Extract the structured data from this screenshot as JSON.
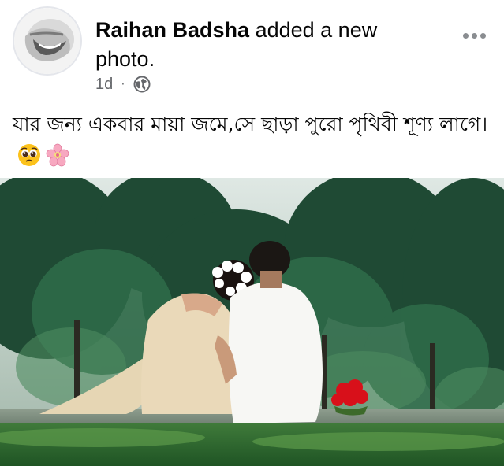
{
  "post": {
    "author": "Raihan Badsha",
    "action_text": "added a new photo.",
    "timestamp": "1d",
    "separator": "·",
    "privacy_icon": "globe-icon",
    "more_icon": "more-horizontal-icon",
    "caption": "যার জন্য একবার মায়া জমে,সে ছাড়া পুরো পৃথিবী শূণ্য লাগে।",
    "caption_emojis": [
      "pleading-face-emoji",
      "cherry-blossom-emoji"
    ],
    "photo_subject": "couple-sitting-photo"
  },
  "colors": {
    "text_primary": "#050505",
    "text_secondary": "#65676b",
    "icon_gray": "#8a8d91",
    "background": "#ffffff"
  }
}
